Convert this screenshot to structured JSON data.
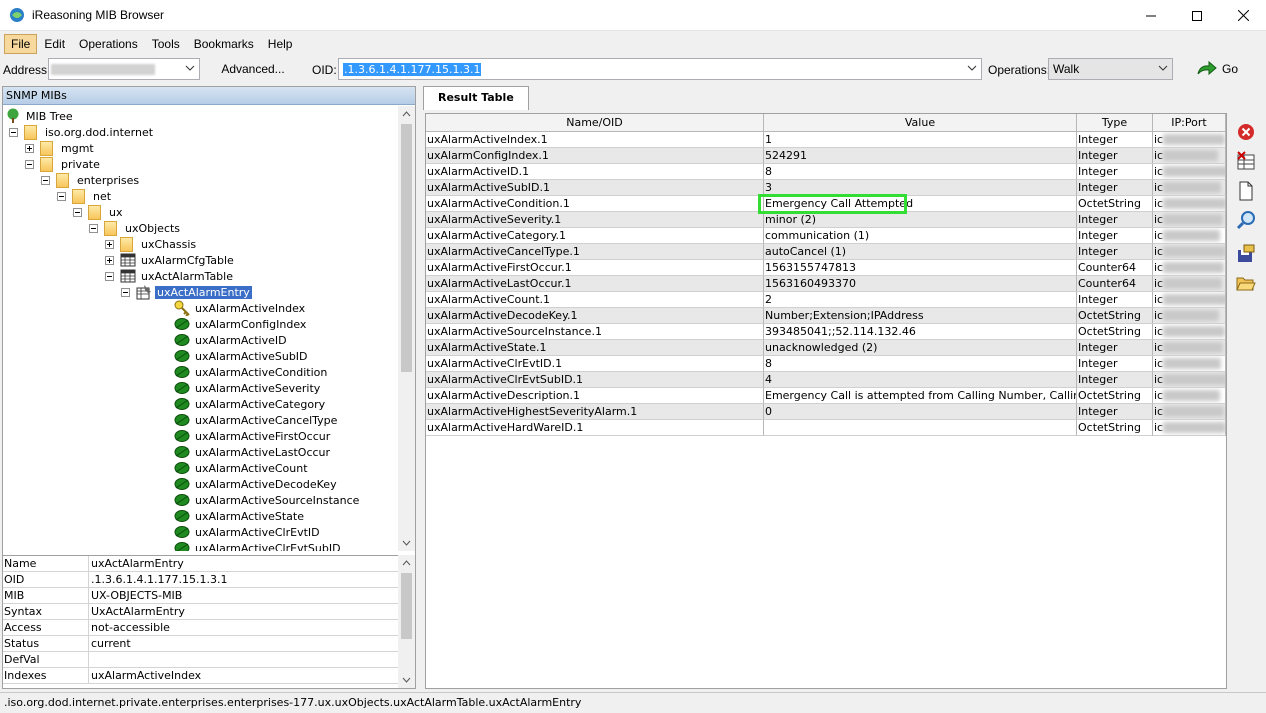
{
  "window": {
    "title": "iReasoning MIB Browser",
    "controls": {
      "minimize": "—",
      "maximize": "☐",
      "close": "✕"
    }
  },
  "menu": [
    "File",
    "Edit",
    "Operations",
    "Tools",
    "Bookmarks",
    "Help"
  ],
  "toolbar": {
    "address_label": "Address:",
    "advanced_label": "Advanced...",
    "oid_label": "OID:",
    "oid_value": ".1.3.6.1.4.1.177.15.1.3.1",
    "operations_label": "Operations:",
    "operations_value": "Walk",
    "go_label": "Go"
  },
  "left_panel": {
    "header": "SNMP MIBs",
    "tree": [
      {
        "label": "MIB Tree",
        "icon": "tree-icon"
      },
      {
        "label": "iso.org.dod.internet",
        "icon": "folder-icon",
        "expander": "minus"
      },
      {
        "label": "mgmt",
        "icon": "folder-icon",
        "expander": "plus"
      },
      {
        "label": "private",
        "icon": "folder-icon",
        "expander": "minus"
      },
      {
        "label": "enterprises",
        "icon": "folder-icon",
        "expander": "minus"
      },
      {
        "label": "net",
        "icon": "folder-icon",
        "expander": "minus"
      },
      {
        "label": "ux",
        "icon": "folder-icon",
        "expander": "minus"
      },
      {
        "label": "uxObjects",
        "icon": "folder-icon",
        "expander": "minus"
      },
      {
        "label": "uxChassis",
        "icon": "folder-icon",
        "expander": "plus"
      },
      {
        "label": "uxAlarmCfgTable",
        "icon": "table-icon",
        "expander": "plus"
      },
      {
        "label": "uxActAlarmTable",
        "icon": "table-icon",
        "expander": "minus"
      },
      {
        "label": "uxActAlarmEntry",
        "icon": "entry-icon",
        "expander": "minus",
        "selected": true
      },
      {
        "label": "uxAlarmActiveIndex",
        "icon": "key-leaf-icon"
      },
      {
        "label": "uxAlarmConfigIndex",
        "icon": "leaf-icon"
      },
      {
        "label": "uxAlarmActiveID",
        "icon": "leaf-icon"
      },
      {
        "label": "uxAlarmActiveSubID",
        "icon": "leaf-icon"
      },
      {
        "label": "uxAlarmActiveCondition",
        "icon": "leaf-icon"
      },
      {
        "label": "uxAlarmActiveSeverity",
        "icon": "leaf-icon"
      },
      {
        "label": "uxAlarmActiveCategory",
        "icon": "leaf-icon"
      },
      {
        "label": "uxAlarmActiveCancelType",
        "icon": "leaf-icon"
      },
      {
        "label": "uxAlarmActiveFirstOccur",
        "icon": "leaf-icon"
      },
      {
        "label": "uxAlarmActiveLastOccur",
        "icon": "leaf-icon"
      },
      {
        "label": "uxAlarmActiveCount",
        "icon": "leaf-icon"
      },
      {
        "label": "uxAlarmActiveDecodeKey",
        "icon": "leaf-icon"
      },
      {
        "label": "uxAlarmActiveSourceInstance",
        "icon": "leaf-icon"
      },
      {
        "label": "uxAlarmActiveState",
        "icon": "leaf-icon"
      },
      {
        "label": "uxAlarmActiveClrEvtID",
        "icon": "leaf-icon"
      },
      {
        "label": "uxAlarmActiveClrEvtSubID",
        "icon": "leaf-icon"
      }
    ],
    "properties": [
      {
        "key": "Name",
        "value": "uxActAlarmEntry"
      },
      {
        "key": "OID",
        "value": ".1.3.6.1.4.1.177.15.1.3.1"
      },
      {
        "key": "MIB",
        "value": "UX-OBJECTS-MIB"
      },
      {
        "key": "Syntax",
        "value": "UxActAlarmEntry"
      },
      {
        "key": "Access",
        "value": "not-accessible"
      },
      {
        "key": "Status",
        "value": "current"
      },
      {
        "key": "DefVal",
        "value": ""
      },
      {
        "key": "Indexes",
        "value": "uxAlarmActiveIndex"
      }
    ]
  },
  "result": {
    "tab_label": "Result Table",
    "columns": [
      "Name/OID",
      "Value",
      "Type",
      "IP:Port"
    ],
    "rows": [
      {
        "name": "uxAlarmActiveIndex.1",
        "value": "1",
        "type": "Integer"
      },
      {
        "name": "uxAlarmConfigIndex.1",
        "value": "524291",
        "type": "Integer"
      },
      {
        "name": "uxAlarmActiveID.1",
        "value": "8",
        "type": "Integer"
      },
      {
        "name": "uxAlarmActiveSubID.1",
        "value": "3",
        "type": "Integer"
      },
      {
        "name": "uxAlarmActiveCondition.1",
        "value": "Emergency Call Attempted",
        "type": "OctetString"
      },
      {
        "name": "uxAlarmActiveSeverity.1",
        "value": "minor (2)",
        "type": "Integer"
      },
      {
        "name": "uxAlarmActiveCategory.1",
        "value": "communication  (1)",
        "type": "Integer"
      },
      {
        "name": "uxAlarmActiveCancelType.1",
        "value": "autoCancel  (1)",
        "type": "Integer"
      },
      {
        "name": "uxAlarmActiveFirstOccur.1",
        "value": "1563155747813",
        "type": "Counter64"
      },
      {
        "name": "uxAlarmActiveLastOccur.1",
        "value": "1563160493370",
        "type": "Counter64"
      },
      {
        "name": "uxAlarmActiveCount.1",
        "value": "2",
        "type": "Integer"
      },
      {
        "name": "uxAlarmActiveDecodeKey.1",
        "value": "Number;Extension;IPAddress",
        "type": "OctetString"
      },
      {
        "name": "uxAlarmActiveSourceInstance.1",
        "value": "393485041;;52.114.132.46",
        "type": "OctetString"
      },
      {
        "name": "uxAlarmActiveState.1",
        "value": "unacknowledged (2)",
        "type": "Integer"
      },
      {
        "name": "uxAlarmActiveClrEvtID.1",
        "value": "8",
        "type": "Integer"
      },
      {
        "name": "uxAlarmActiveClrEvtSubID.1",
        "value": "4",
        "type": "Integer"
      },
      {
        "name": "uxAlarmActiveDescription.1",
        "value": "Emergency Call is attempted from Calling Number, Calling Exte...",
        "type": "OctetString"
      },
      {
        "name": "uxAlarmActiveHighestSeverityAlarm.1",
        "value": "0",
        "type": "Integer"
      },
      {
        "name": "uxAlarmActiveHardWareID.1",
        "value": "",
        "type": "OctetString"
      }
    ],
    "ip_prefix": "ic",
    "highlight_color": "#33dd33"
  },
  "side_tools": [
    "close-red-icon",
    "delete-table-icon",
    "new-document-icon",
    "search-icon",
    "save-icon",
    "open-folder-icon"
  ],
  "status": ".iso.org.dod.internet.private.enterprises.enterprises-177.ux.uxObjects.uxActAlarmTable.uxActAlarmEntry"
}
